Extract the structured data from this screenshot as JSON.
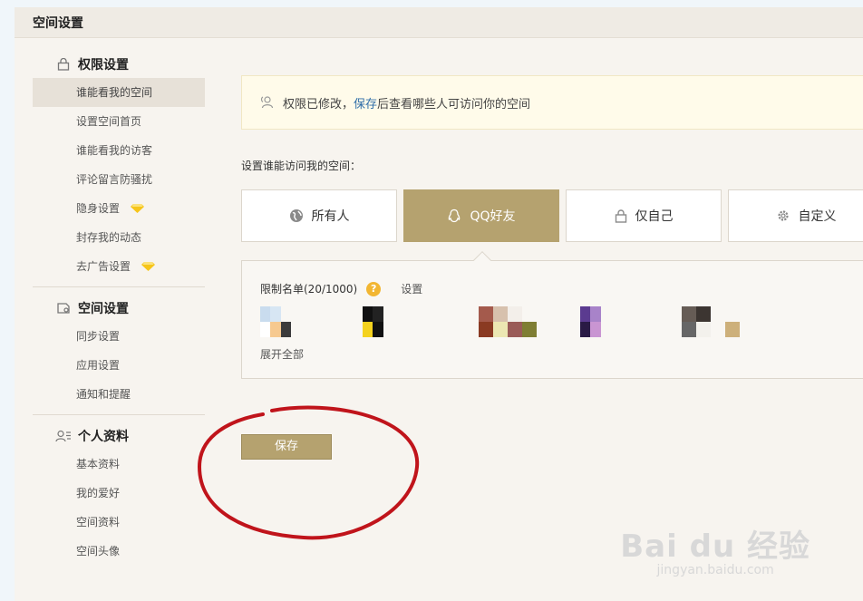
{
  "window": {
    "title": "空间设置"
  },
  "sidebar": {
    "groups": [
      {
        "title": "权限设置",
        "icon": "lock-icon",
        "items": [
          "谁能看我的空间",
          "设置空间首页",
          "谁能看我的访客",
          "评论留言防骚扰",
          "隐身设置",
          "封存我的动态",
          "去广告设置"
        ]
      },
      {
        "title": "空间设置",
        "icon": "space-settings-icon",
        "items": [
          "同步设置",
          "应用设置",
          "通知和提醒"
        ]
      },
      {
        "title": "个人资料",
        "icon": "profile-icon",
        "items": [
          "基本资料",
          "我的爱好",
          "空间资料",
          "空间头像"
        ]
      }
    ]
  },
  "notice": {
    "prefix": "权限已修改，",
    "link": "保存",
    "suffix": "后查看哪些人可访问你的空间"
  },
  "main": {
    "section_label": "设置谁能访问我的空间：",
    "options": [
      "所有人",
      "QQ好友",
      "仅自己",
      "自定义"
    ],
    "selected_option": "QQ好友",
    "restrict": {
      "title": "限制名单(20/1000)",
      "help": "?",
      "set_link": "设置",
      "expand": "展开全部"
    },
    "save_label": "保存"
  },
  "watermark": {
    "logo": "Bai du 经验",
    "url": "jingyan.baidu.com"
  },
  "colors": {
    "accent": "#b5a26f",
    "link": "#2f6ea8",
    "annotation": "#c0141b",
    "help": "#f2b632"
  }
}
